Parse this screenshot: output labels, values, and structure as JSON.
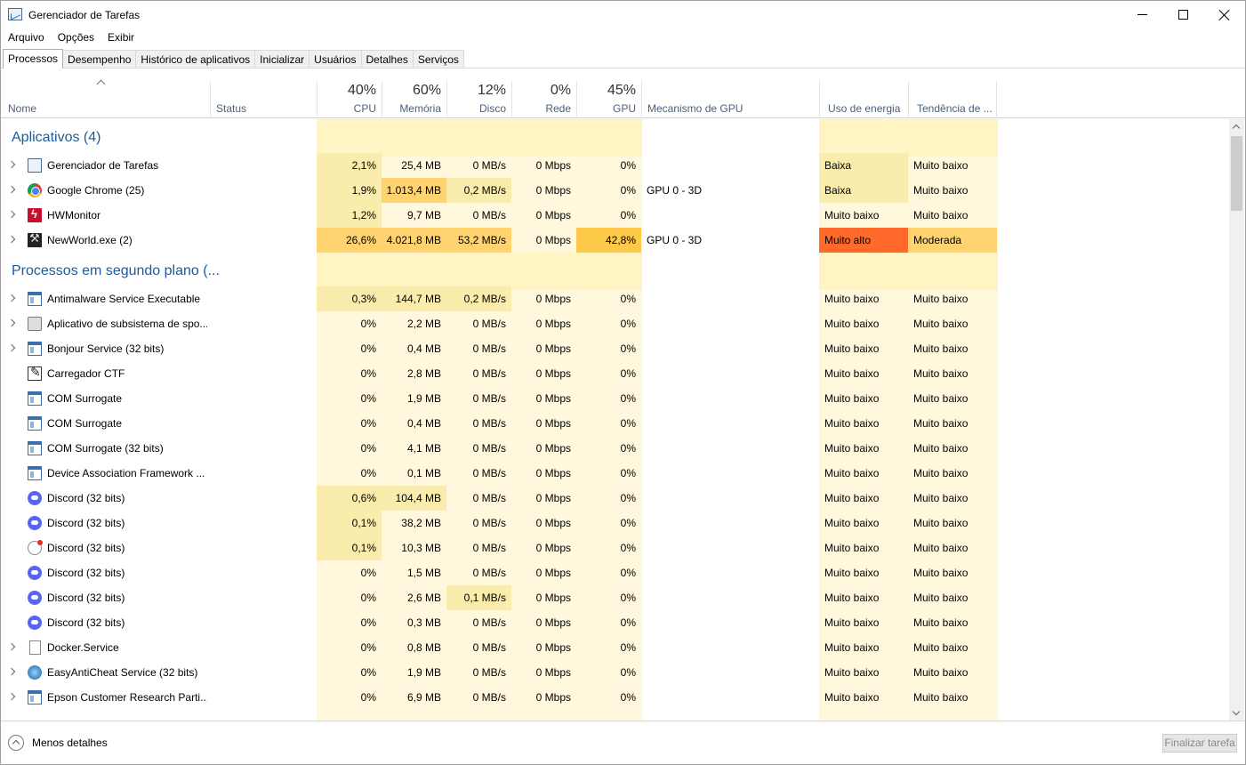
{
  "window": {
    "title": "Gerenciador de Tarefas"
  },
  "menu": [
    "Arquivo",
    "Opções",
    "Exibir"
  ],
  "tabs": [
    "Processos",
    "Desempenho",
    "Histórico de aplicativos",
    "Inicializar",
    "Usuários",
    "Detalhes",
    "Serviços"
  ],
  "active_tab": "Processos",
  "columns": {
    "name": "Nome",
    "status": "Status",
    "cpu": {
      "pct": "40%",
      "label": "CPU"
    },
    "mem": {
      "pct": "60%",
      "label": "Memória"
    },
    "disk": {
      "pct": "12%",
      "label": "Disco"
    },
    "net": {
      "pct": "0%",
      "label": "Rede"
    },
    "gpu": {
      "pct": "45%",
      "label": "GPU"
    },
    "gpu_engine": "Mecanismo de GPU",
    "power": "Uso de energia",
    "power_trend": "Tendência de ..."
  },
  "groups": {
    "apps": "Aplicativos (4)",
    "background": "Processos em segundo plano (..."
  },
  "apps": [
    {
      "name": "Gerenciador de Tarefas",
      "icon": "task-manager-icon",
      "cpu": "2,1%",
      "mem": "25,4 MB",
      "disk": "0 MB/s",
      "net": "0 Mbps",
      "gpu": "0%",
      "engine": "",
      "power": "Baixa",
      "trend": "Muito baixo"
    },
    {
      "name": "Google Chrome (25)",
      "icon": "chrome-icon",
      "cpu": "1,9%",
      "mem": "1.013,4 MB",
      "disk": "0,2 MB/s",
      "net": "0 Mbps",
      "gpu": "0%",
      "engine": "GPU 0 - 3D",
      "power": "Baixa",
      "trend": "Muito baixo"
    },
    {
      "name": "HWMonitor",
      "icon": "hwmonitor-icon",
      "cpu": "1,2%",
      "mem": "9,7 MB",
      "disk": "0 MB/s",
      "net": "0 Mbps",
      "gpu": "0%",
      "engine": "",
      "power": "Muito baixo",
      "trend": "Muito baixo"
    },
    {
      "name": "NewWorld.exe (2)",
      "icon": "newworld-icon",
      "cpu": "26,6%",
      "mem": "4.021,8 MB",
      "disk": "53,2 MB/s",
      "net": "0 Mbps",
      "gpu": "42,8%",
      "engine": "GPU 0 - 3D",
      "power": "Muito alto",
      "trend": "Moderada"
    }
  ],
  "background": [
    {
      "name": "Antimalware Service Executable",
      "icon": "service-window-icon",
      "exp": true,
      "cpu": "0,3%",
      "mem": "144,7 MB",
      "disk": "0,2 MB/s",
      "net": "0 Mbps",
      "gpu": "0%",
      "power": "Muito baixo",
      "trend": "Muito baixo"
    },
    {
      "name": "Aplicativo de subsistema de spo...",
      "icon": "printer-icon",
      "exp": true,
      "cpu": "0%",
      "mem": "2,2 MB",
      "disk": "0 MB/s",
      "net": "0 Mbps",
      "gpu": "0%",
      "power": "Muito baixo",
      "trend": "Muito baixo"
    },
    {
      "name": "Bonjour Service (32 bits)",
      "icon": "service-window-icon",
      "exp": true,
      "cpu": "0%",
      "mem": "0,4 MB",
      "disk": "0 MB/s",
      "net": "0 Mbps",
      "gpu": "0%",
      "power": "Muito baixo",
      "trend": "Muito baixo"
    },
    {
      "name": "Carregador CTF",
      "icon": "ctf-loader-icon",
      "exp": false,
      "cpu": "0%",
      "mem": "2,8 MB",
      "disk": "0 MB/s",
      "net": "0 Mbps",
      "gpu": "0%",
      "power": "Muito baixo",
      "trend": "Muito baixo"
    },
    {
      "name": "COM Surrogate",
      "icon": "service-window-icon",
      "exp": false,
      "cpu": "0%",
      "mem": "1,9 MB",
      "disk": "0 MB/s",
      "net": "0 Mbps",
      "gpu": "0%",
      "power": "Muito baixo",
      "trend": "Muito baixo"
    },
    {
      "name": "COM Surrogate",
      "icon": "service-window-icon",
      "exp": false,
      "cpu": "0%",
      "mem": "0,4 MB",
      "disk": "0 MB/s",
      "net": "0 Mbps",
      "gpu": "0%",
      "power": "Muito baixo",
      "trend": "Muito baixo"
    },
    {
      "name": "COM Surrogate (32 bits)",
      "icon": "service-window-icon",
      "exp": false,
      "cpu": "0%",
      "mem": "4,1 MB",
      "disk": "0 MB/s",
      "net": "0 Mbps",
      "gpu": "0%",
      "power": "Muito baixo",
      "trend": "Muito baixo"
    },
    {
      "name": "Device Association Framework ...",
      "icon": "service-window-icon",
      "exp": false,
      "cpu": "0%",
      "mem": "0,1 MB",
      "disk": "0 MB/s",
      "net": "0 Mbps",
      "gpu": "0%",
      "power": "Muito baixo",
      "trend": "Muito baixo"
    },
    {
      "name": "Discord (32 bits)",
      "icon": "discord-icon",
      "exp": false,
      "cpu": "0,6%",
      "mem": "104,4 MB",
      "disk": "0 MB/s",
      "net": "0 Mbps",
      "gpu": "0%",
      "power": "Muito baixo",
      "trend": "Muito baixo"
    },
    {
      "name": "Discord (32 bits)",
      "icon": "discord-icon",
      "exp": false,
      "cpu": "0,1%",
      "mem": "38,2 MB",
      "disk": "0 MB/s",
      "net": "0 Mbps",
      "gpu": "0%",
      "power": "Muito baixo",
      "trend": "Muito baixo"
    },
    {
      "name": "Discord (32 bits)",
      "icon": "discord-alert-icon",
      "exp": false,
      "cpu": "0,1%",
      "mem": "10,3 MB",
      "disk": "0 MB/s",
      "net": "0 Mbps",
      "gpu": "0%",
      "power": "Muito baixo",
      "trend": "Muito baixo"
    },
    {
      "name": "Discord (32 bits)",
      "icon": "discord-icon",
      "exp": false,
      "cpu": "0%",
      "mem": "1,5 MB",
      "disk": "0 MB/s",
      "net": "0 Mbps",
      "gpu": "0%",
      "power": "Muito baixo",
      "trend": "Muito baixo"
    },
    {
      "name": "Discord (32 bits)",
      "icon": "discord-icon",
      "exp": false,
      "cpu": "0%",
      "mem": "2,6 MB",
      "disk": "0,1 MB/s",
      "net": "0 Mbps",
      "gpu": "0%",
      "power": "Muito baixo",
      "trend": "Muito baixo"
    },
    {
      "name": "Discord (32 bits)",
      "icon": "discord-icon",
      "exp": false,
      "cpu": "0%",
      "mem": "0,3 MB",
      "disk": "0 MB/s",
      "net": "0 Mbps",
      "gpu": "0%",
      "power": "Muito baixo",
      "trend": "Muito baixo"
    },
    {
      "name": "Docker.Service",
      "icon": "file-icon",
      "exp": true,
      "cpu": "0%",
      "mem": "0,8 MB",
      "disk": "0 MB/s",
      "net": "0 Mbps",
      "gpu": "0%",
      "power": "Muito baixo",
      "trend": "Muito baixo"
    },
    {
      "name": "EasyAntiCheat Service (32 bits)",
      "icon": "easyanticheat-icon",
      "exp": true,
      "cpu": "0%",
      "mem": "1,9 MB",
      "disk": "0 MB/s",
      "net": "0 Mbps",
      "gpu": "0%",
      "power": "Muito baixo",
      "trend": "Muito baixo"
    },
    {
      "name": "Epson Customer Research Parti...",
      "icon": "service-window-icon",
      "exp": true,
      "cpu": "0%",
      "mem": "6,9 MB",
      "disk": "0 MB/s",
      "net": "0 Mbps",
      "gpu": "0%",
      "power": "Muito baixo",
      "trend": "Muito baixo"
    }
  ],
  "footer": {
    "less_details": "Menos detalhes",
    "end_task": "Finalizar tarefa"
  },
  "colors": {
    "heat_light": "#fff4c4",
    "heat_mid": "#f9ecad",
    "heat_high": "#ffd36f",
    "heat_gpu_high": "#ffc94a",
    "power_critical": "#ff6a2b",
    "column_bg": "#fff8dd",
    "group_title": "#1f5a96"
  }
}
